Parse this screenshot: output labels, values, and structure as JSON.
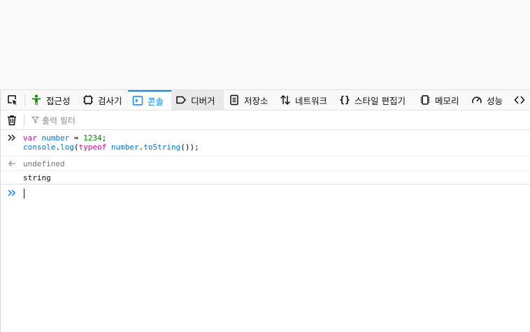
{
  "devtools": {
    "tabs": [
      {
        "label": "접근성",
        "icon": "accessibility-icon"
      },
      {
        "label": "검사기",
        "icon": "inspector-icon"
      },
      {
        "label": "콘솔",
        "icon": "console-icon",
        "active": true
      },
      {
        "label": "디버거",
        "icon": "debugger-icon"
      },
      {
        "label": "저장소",
        "icon": "storage-icon"
      },
      {
        "label": "네트워크",
        "icon": "network-icon"
      },
      {
        "label": "스타일 편집기",
        "icon": "style-editor-icon"
      },
      {
        "label": "메모리",
        "icon": "memory-icon"
      },
      {
        "label": "성능",
        "icon": "performance-icon"
      }
    ],
    "colors": {
      "accent": "#0a84ff",
      "accessibility": "#058b00"
    }
  },
  "console": {
    "filter_placeholder": "출력 필터",
    "input": {
      "line1": [
        "var",
        "number",
        "= ",
        "1234",
        ";"
      ],
      "line2": [
        "console",
        ".",
        "log",
        "(",
        "typeof",
        " ",
        "number",
        ".",
        "toString",
        "());"
      ]
    },
    "result": "undefined",
    "output": "string"
  }
}
